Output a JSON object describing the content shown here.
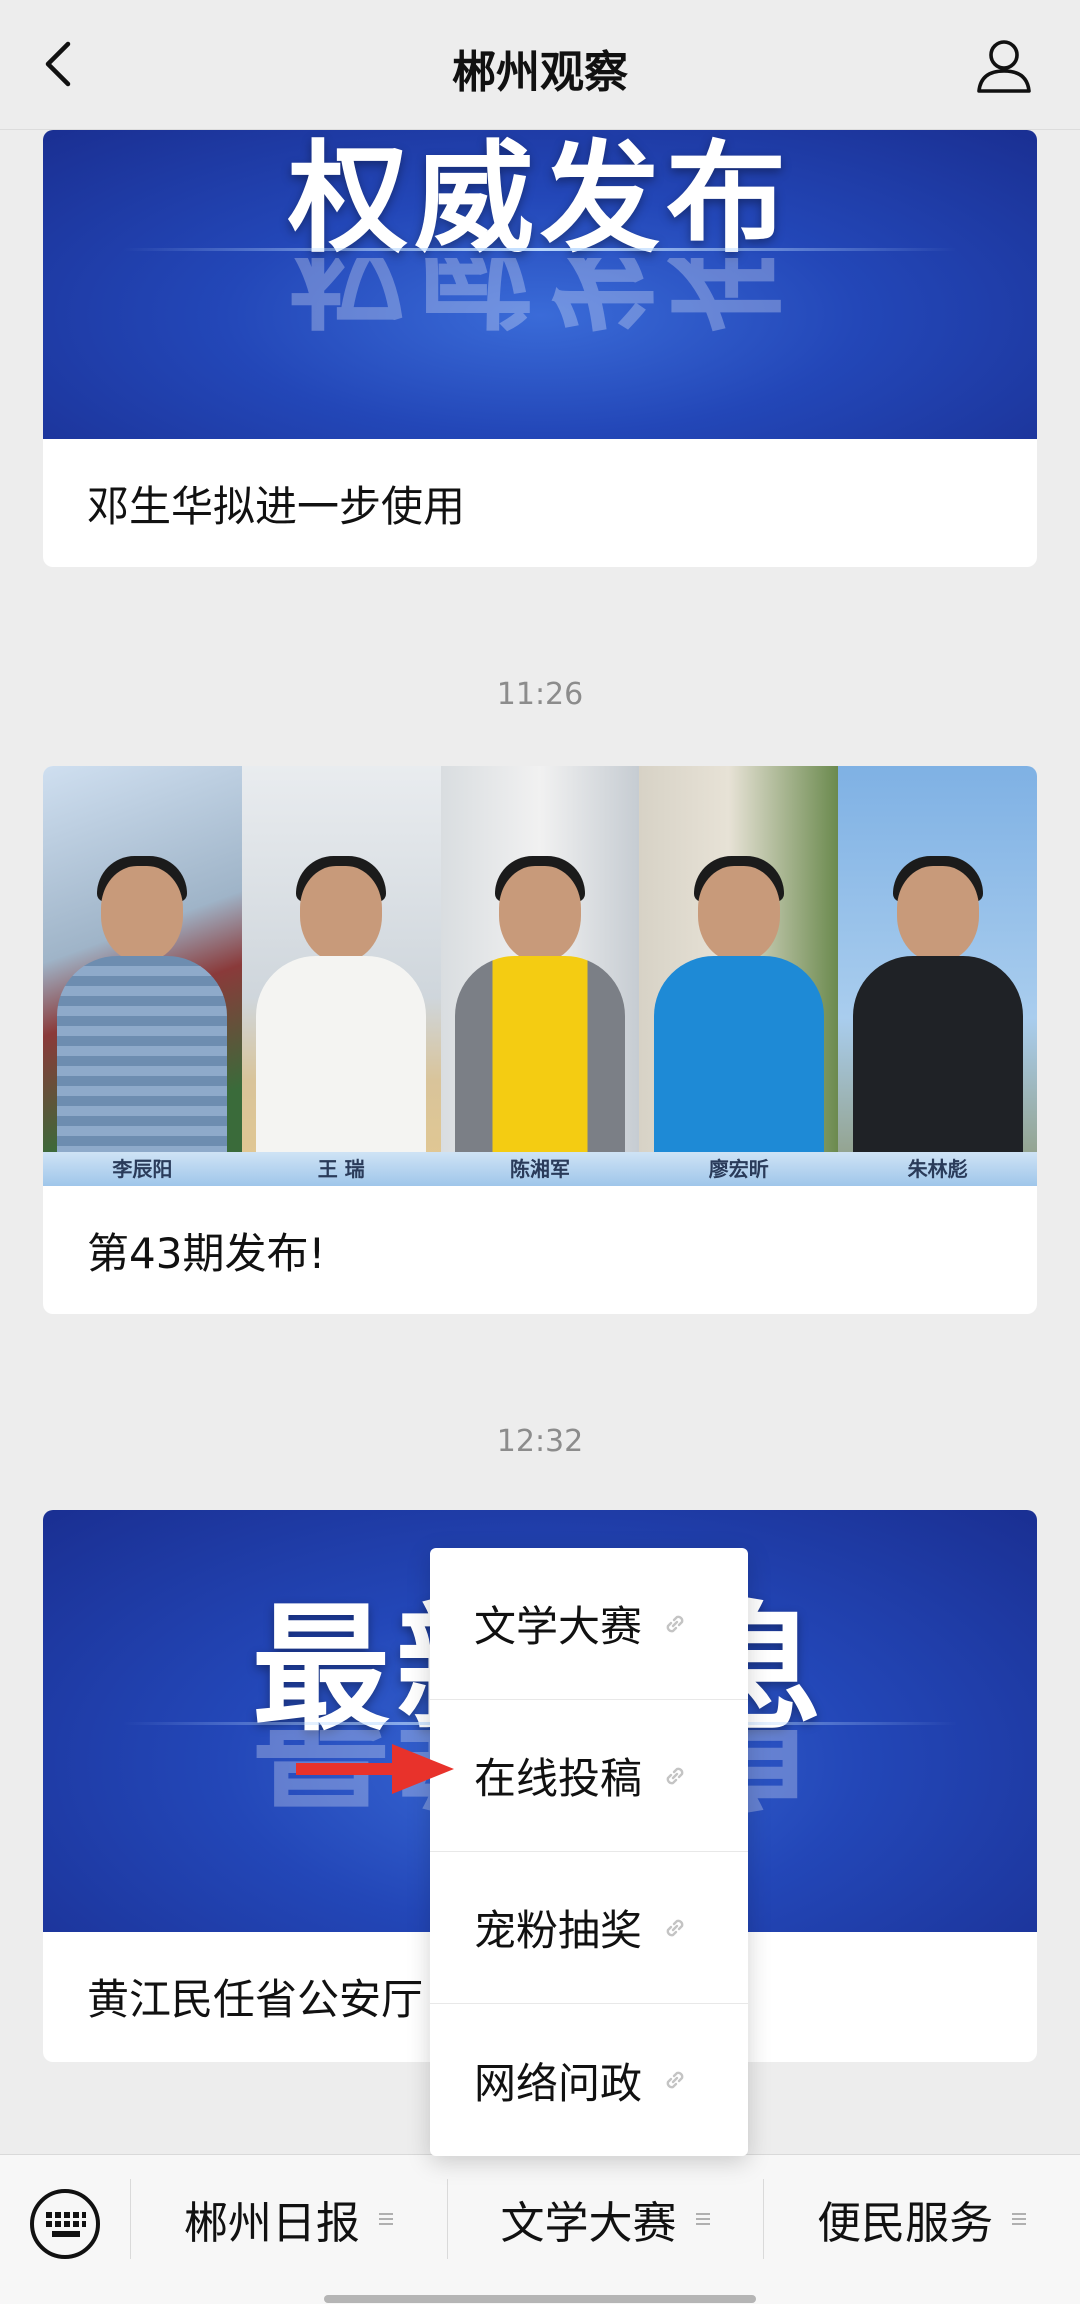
{
  "header": {
    "title": "郴州观察",
    "back_icon": "chevron-left-icon",
    "profile_icon": "user-icon"
  },
  "feed": {
    "card1": {
      "banner_text": "权威发布",
      "caption": "邓生华拟进一步使用"
    },
    "time1": "11:26",
    "card2": {
      "caption": "第43期发布!",
      "people": [
        {
          "name": "李辰阳"
        },
        {
          "name": "王 瑞"
        },
        {
          "name": "陈湘军"
        },
        {
          "name": "廖宏昕"
        },
        {
          "name": "朱林彪"
        }
      ]
    },
    "time2": "12:32",
    "card3": {
      "banner_text": "最新消息",
      "caption": "黄江民任省公安厅"
    }
  },
  "popup": {
    "items": [
      {
        "label": "文学大赛"
      },
      {
        "label": "在线投稿"
      },
      {
        "label": "宠粉抽奖"
      },
      {
        "label": "网络问政"
      }
    ],
    "arrow_color": "#e8322b"
  },
  "bottom_menu": {
    "items": [
      {
        "label": "郴州日报"
      },
      {
        "label": "文学大赛"
      },
      {
        "label": "便民服务"
      }
    ]
  }
}
